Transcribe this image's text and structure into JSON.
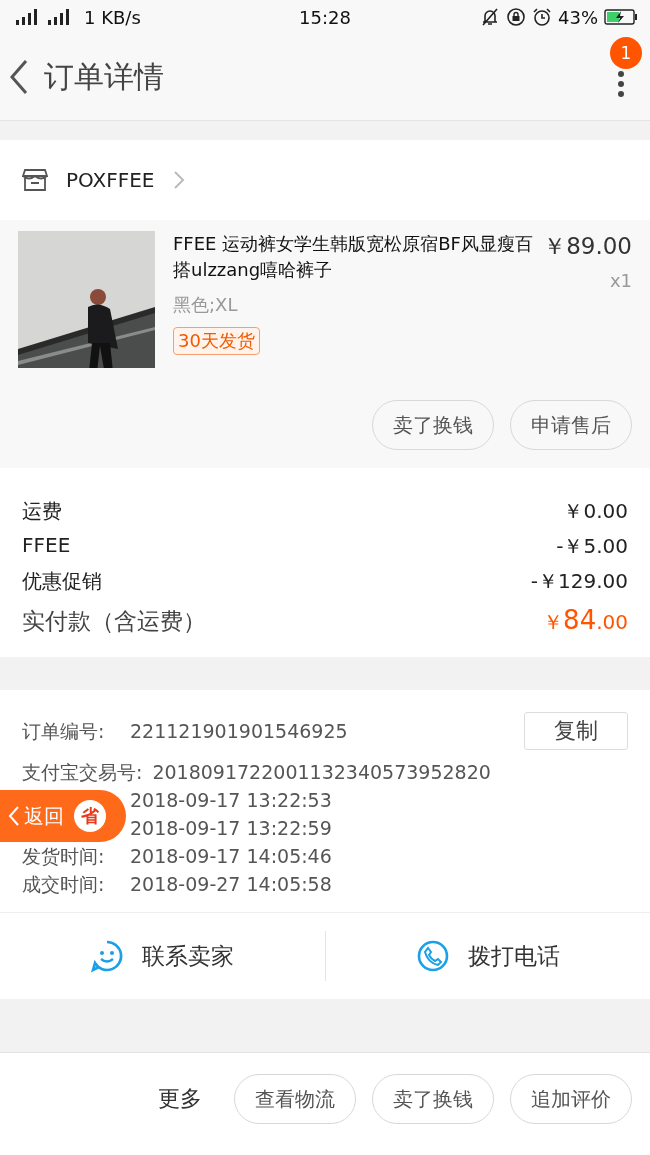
{
  "status_bar": {
    "network": "1 KB/s",
    "time": "15:28",
    "battery": "43%"
  },
  "header": {
    "title": "订单详情",
    "badge": "1"
  },
  "shop": {
    "name": "POXFFEE"
  },
  "item": {
    "title": "FFEE 运动裤女学生韩版宽松原宿BF风显瘦百搭ulzzang嘻哈裤子",
    "price": "￥89.00",
    "quantity": "x1",
    "variant": "黑色;XL",
    "tag": "30天发货",
    "actions": [
      "卖了换钱",
      "申请售后"
    ]
  },
  "charges": [
    {
      "label": "运费",
      "value": "￥0.00"
    },
    {
      "label": "FFEE",
      "value": "-￥5.00"
    },
    {
      "label": "优惠促销",
      "value": "-￥129.00"
    }
  ],
  "total": {
    "label": "实付款（含运费）",
    "symbol": "￥",
    "amount": "84",
    "decimals": ".00"
  },
  "info": [
    {
      "label": "订单编号:",
      "value": "221121901901546925",
      "copy_button": "复制"
    },
    {
      "label": "支付宝交易号:",
      "value": "2018091722001132340573952820"
    },
    {
      "value": "2018-09-17 13:22:53"
    },
    {
      "value": "2018-09-17 13:22:59"
    },
    {
      "label": "发货时间:",
      "value": "2018-09-17 14:05:46"
    },
    {
      "label": "成交时间:",
      "value": "2018-09-27 14:05:58"
    }
  ],
  "contact": [
    {
      "kind": "chat",
      "label": "联系卖家"
    },
    {
      "kind": "phone",
      "label": "拨打电话"
    }
  ],
  "floating_back": {
    "label": "返回",
    "badge": "省"
  },
  "bottom_bar": {
    "more": "更多",
    "buttons": [
      "查看物流",
      "卖了换钱",
      "追加评价"
    ]
  }
}
